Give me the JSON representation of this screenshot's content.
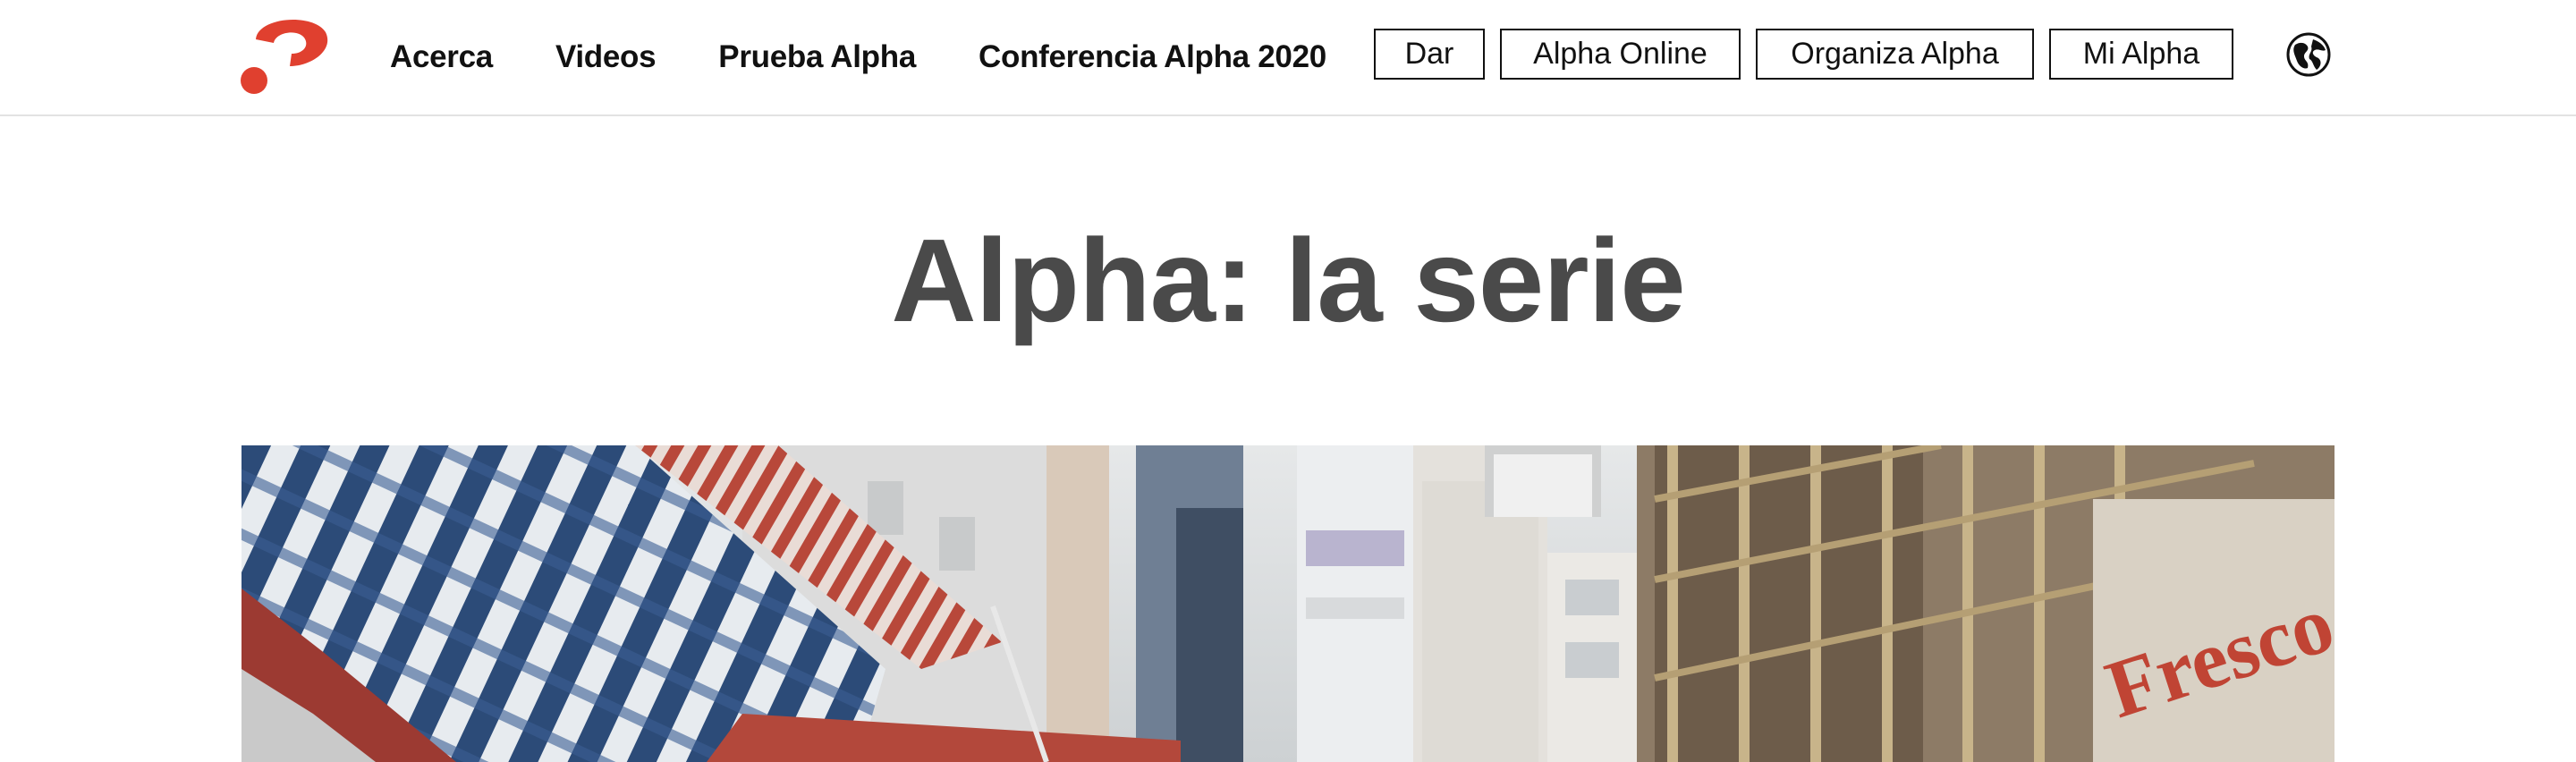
{
  "header": {
    "nav": [
      "Acerca",
      "Videos",
      "Prueba Alpha",
      "Conferencia Alpha 2020"
    ],
    "buttons": [
      "Dar",
      "Alpha Online",
      "Organiza Alpha",
      "Mi Alpha"
    ],
    "icons": {
      "logo": "alpha-question-mark-logo",
      "language": "globe-icon"
    }
  },
  "main": {
    "title": "Alpha: la serie",
    "hero": {
      "sign_text": "Fresco"
    }
  },
  "colors": {
    "brand": "#e0402f",
    "title": "#4a4a4a",
    "text": "#111111"
  }
}
